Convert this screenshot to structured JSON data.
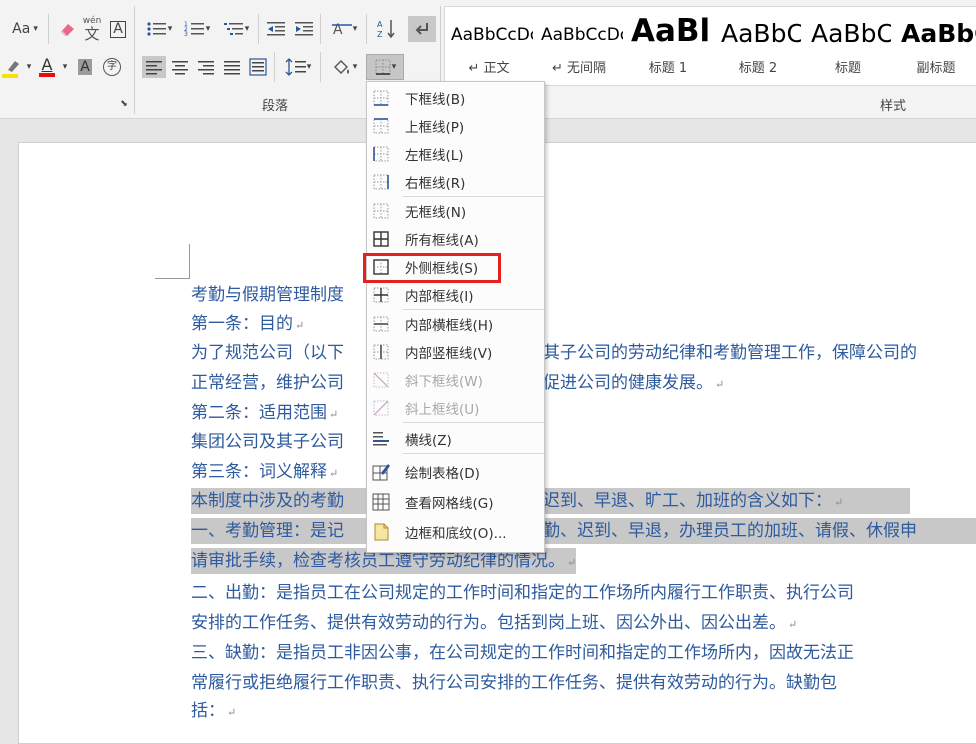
{
  "ribbon": {
    "font_size_button": "Aa",
    "wen_label": "wén",
    "zi_label": "文",
    "boxed_a": "A",
    "font_color_a": "A",
    "circled_zi": "字",
    "group_paragraph": "段落",
    "group_styles": "样式",
    "highlight_color": "#f2e600",
    "font_color": "#e01010"
  },
  "styles": [
    {
      "sample": "AaBbCcDc",
      "name": "↵ 正文"
    },
    {
      "sample": "AaBbCcDc",
      "name": "↵ 无间隔"
    },
    {
      "sample": "AaBl",
      "name": "标题 1"
    },
    {
      "sample": "AaBbC",
      "name": "标题 2"
    },
    {
      "sample": "AaBbC",
      "name": "标题"
    },
    {
      "sample": "AaBbC",
      "name": "副标题"
    }
  ],
  "menu": {
    "items": [
      {
        "label": "下框线(B)"
      },
      {
        "label": "上框线(P)"
      },
      {
        "label": "左框线(L)"
      },
      {
        "label": "右框线(R)"
      },
      {
        "label": "无框线(N)"
      },
      {
        "label": "所有框线(A)"
      },
      {
        "label": "外侧框线(S)"
      },
      {
        "label": "内部框线(I)"
      },
      {
        "label": "内部横框线(H)"
      },
      {
        "label": "内部竖框线(V)"
      },
      {
        "label": "斜下框线(W)"
      },
      {
        "label": "斜上框线(U)"
      },
      {
        "label": "横线(Z)"
      },
      {
        "label": "绘制表格(D)"
      },
      {
        "label": "查看网格线(G)"
      },
      {
        "label": "边框和底纹(O)..."
      }
    ]
  },
  "document": {
    "lines": [
      {
        "text": "考勤与假期管理制度",
        "mark": ""
      },
      {
        "text": "第一条：目的",
        "mark": "↵"
      },
      {
        "text": "为了规范公司（以下",
        "tail": "其子公司的劳动纪律和考勤管理工作，保障公司的",
        "mark": ""
      },
      {
        "text": "正常经营，维护公司",
        "tail": "促进公司的健康发展。",
        "mark": "↵"
      },
      {
        "text": "第二条：适用范围",
        "mark": "↵"
      },
      {
        "text": "集团公司及其子公司",
        "mark": ""
      },
      {
        "text": "第三条：词义解释",
        "mark": "↵"
      },
      {
        "text": "本制度中涉及的考勤",
        "tail": "迟到、早退、旷工、加班的含义如下：",
        "mark": "↵"
      },
      {
        "text": "一、考勤管理：是记",
        "tail": "勤、迟到、早退，办理员工的加班、请假、休假申",
        "mark": ""
      },
      {
        "text": "请审批手续，检查考核员工遵守劳动纪律的情况。",
        "mark": "↵"
      },
      {
        "text": "二、出勤：是指员工在公司规定的工作时间和指定的工作场所内履行工作职责、执行公司",
        "mark": ""
      },
      {
        "text": "安排的工作任务、提供有效劳动的行为。包括到岗上班、因公外出、因公出差。",
        "mark": "↵"
      },
      {
        "text": "三、缺勤：是指员工非因公事，在公司规定的工作时间和指定的工作场所内，因故无法正",
        "mark": ""
      },
      {
        "text": "常履行或拒绝履行工作职责、执行公司安排的工作任务、提供有效劳动的行为。缺勤包",
        "mark": ""
      },
      {
        "text": "括：",
        "mark": "↵"
      }
    ]
  }
}
